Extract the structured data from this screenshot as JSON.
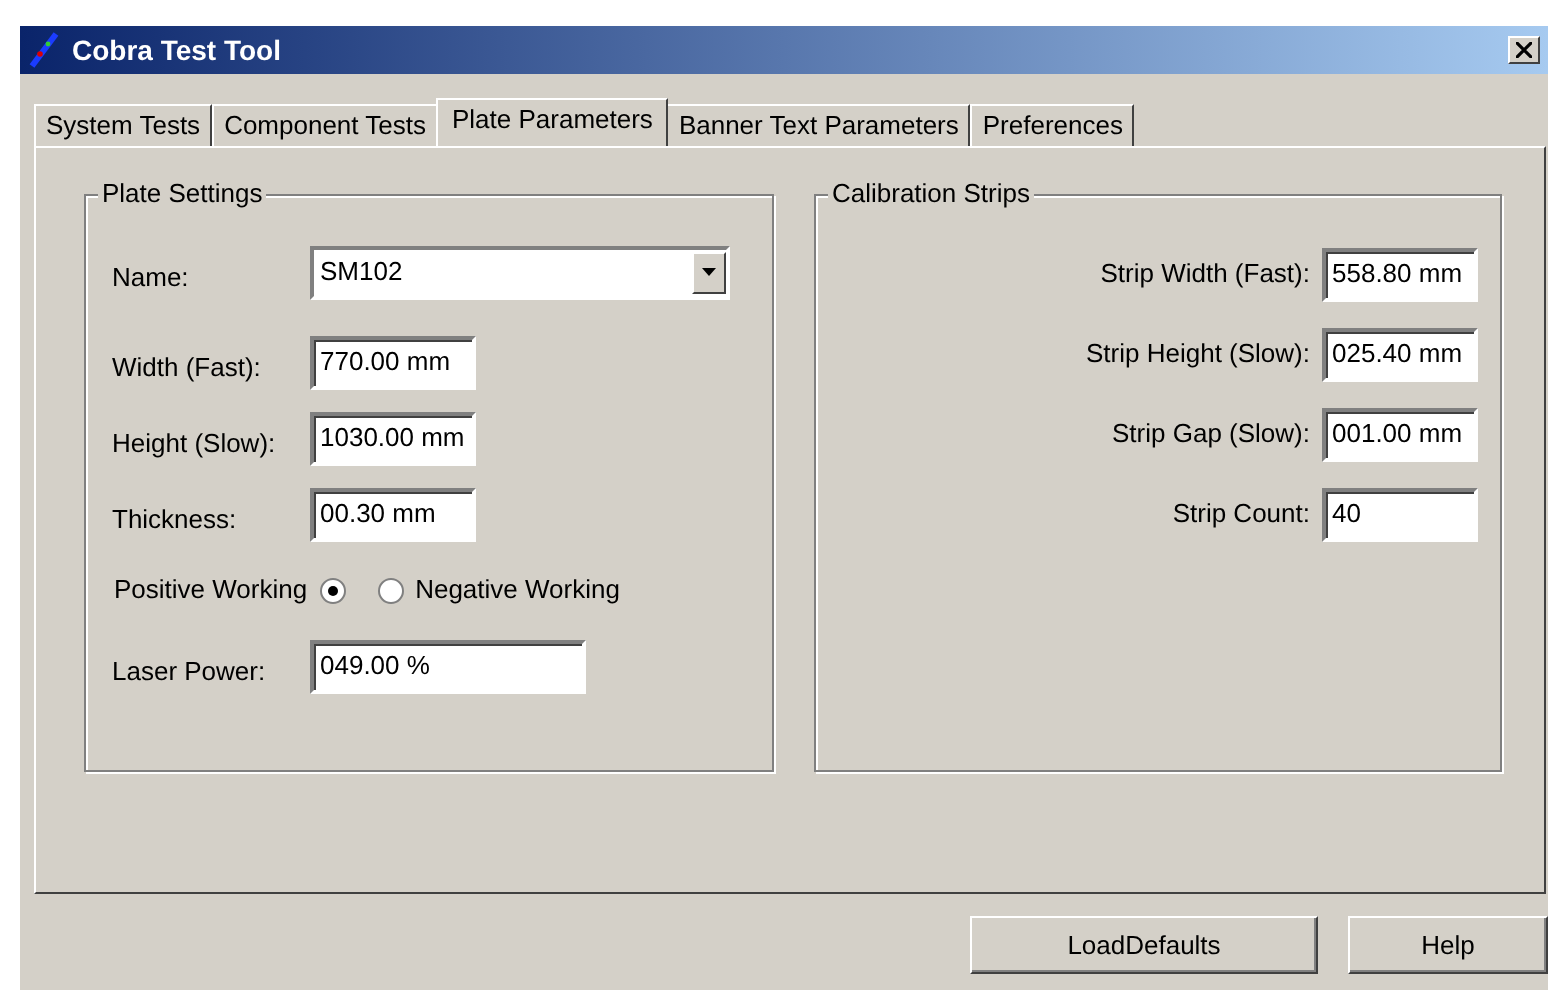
{
  "window": {
    "title": "Cobra Test Tool"
  },
  "tabs": [
    {
      "label": "System Tests",
      "selected": false
    },
    {
      "label": "Component Tests",
      "selected": false
    },
    {
      "label": "Plate Parameters",
      "selected": true
    },
    {
      "label": "Banner Text Parameters",
      "selected": false
    },
    {
      "label": "Preferences",
      "selected": false
    }
  ],
  "plate_settings": {
    "title": "Plate Settings",
    "rows": [
      {
        "kind": "combo",
        "label": "Name:",
        "value": "SM102"
      },
      {
        "kind": "text",
        "label": "Width (Fast):",
        "value": "770.00 mm"
      },
      {
        "kind": "text",
        "label": "Height (Slow):",
        "value": "1030.00 mm"
      },
      {
        "kind": "text",
        "label": "Thickness:",
        "value": "00.30 mm"
      },
      {
        "kind": "radio",
        "options": [
          {
            "label": "Positive Working",
            "selected": true
          },
          {
            "label": "Negative Working",
            "selected": false
          }
        ]
      },
      {
        "kind": "wide",
        "label": "Laser Power:",
        "value": "049.00 %"
      }
    ]
  },
  "calibration_strips": {
    "title": "Calibration Strips",
    "fields": [
      {
        "label": "Strip Width (Fast):",
        "value": "558.80 mm"
      },
      {
        "label": "Strip Height (Slow):",
        "value": "025.40 mm"
      },
      {
        "label": "Strip Gap (Slow):",
        "value": "001.00 mm"
      },
      {
        "label": "Strip Count:",
        "value": "40"
      }
    ]
  },
  "buttons": [
    "LoadDefaults",
    "Help"
  ]
}
